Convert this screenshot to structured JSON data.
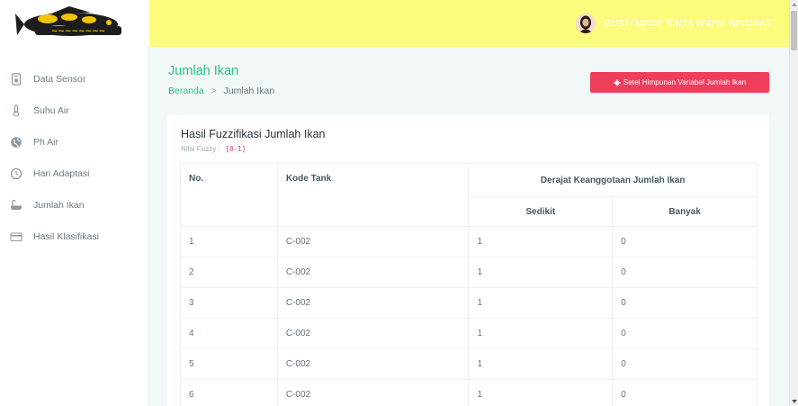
{
  "logo": {
    "icon": "fish-logo"
  },
  "topbar": {
    "user_name": "I GUSTI MADE SINTA WIDYA NINGRAT",
    "avatar_icon": "user-avatar"
  },
  "sidebar": {
    "items": [
      {
        "label": "Data Sensor",
        "icon": "sensor-icon"
      },
      {
        "label": "Suhu Air",
        "icon": "thermometer-icon"
      },
      {
        "label": "Ph Air",
        "icon": "globe-icon"
      },
      {
        "label": "Hari Adaptasi",
        "icon": "clock-icon"
      },
      {
        "label": "Jumlah Ikan",
        "icon": "bath-icon"
      },
      {
        "label": "Hasil Klasifikasi",
        "icon": "card-icon"
      }
    ]
  },
  "page": {
    "title": "Jumlah Ikan",
    "breadcrumb": {
      "home": "Beranda",
      "separator": ">",
      "current": "Jumlah Ikan"
    },
    "action_button": "Setel Himpunan Variabel Jumlah Ikan"
  },
  "card": {
    "title": "Hasil Fuzzifikasi Jumlah Ikan",
    "subtitle_label": "Nilai Fuzzy :",
    "subtitle_code": "[0-1]"
  },
  "table": {
    "headers": {
      "no": "No.",
      "kode_tank": "Kode Tank",
      "group": "Derajat Keanggotaan Jumlah Ikan",
      "sedikit": "Sedikit",
      "banyak": "Banyak"
    },
    "rows": [
      {
        "no": "1",
        "kode": "C-002",
        "sedikit": "1",
        "banyak": "0"
      },
      {
        "no": "2",
        "kode": "C-002",
        "sedikit": "1",
        "banyak": "0"
      },
      {
        "no": "3",
        "kode": "C-002",
        "sedikit": "1",
        "banyak": "0"
      },
      {
        "no": "4",
        "kode": "C-002",
        "sedikit": "1",
        "banyak": "0"
      },
      {
        "no": "5",
        "kode": "C-002",
        "sedikit": "1",
        "banyak": "0"
      },
      {
        "no": "6",
        "kode": "C-002",
        "sedikit": "1",
        "banyak": "0"
      }
    ]
  },
  "colors": {
    "accent": "#26c281",
    "button": "#ef3e5c",
    "topbar": "#fcfc7c"
  }
}
